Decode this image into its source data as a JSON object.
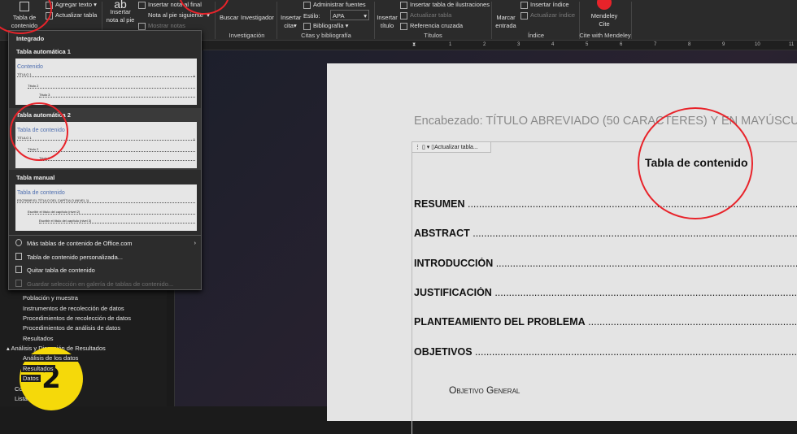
{
  "ribbon": {
    "toc_button": "Tabla de contenido",
    "add_text": "Agregar texto",
    "update_table": "Actualizar tabla",
    "insert_footnote": "Insertar nota al pie",
    "insert_endnote": "Insertar nota al final",
    "next_footnote": "Nota al pie siguiente",
    "show_notes": "Mostrar notas",
    "search": "Buscar",
    "researcher": "Investigador",
    "group_research": "Investigación",
    "insert_citation": "Insertar cita",
    "manage_sources": "Administrar fuentes",
    "style_label": "Estilo:",
    "style_value": "APA",
    "bibliography": "Bibliografía",
    "group_citations": "Citas y bibliografía",
    "insert_caption": "Insertar título",
    "insert_table_figures": "Insertar tabla de ilustraciones",
    "update_table_captions": "Actualizar tabla",
    "cross_reference": "Referencia cruzada",
    "group_captions": "Títulos",
    "mark_entry": "Marcar entrada",
    "insert_index": "Insertar índice",
    "update_index": "Actualizar índice",
    "group_index": "Índice",
    "mendeley": "Mendeley Cite",
    "group_mendeley": "Cite with Mendeley"
  },
  "ruler": [
    "1",
    "2",
    "3",
    "4",
    "5",
    "6",
    "7",
    "8",
    "9",
    "10",
    "11"
  ],
  "menu": {
    "section": "Integrado",
    "auto1": {
      "label": "Tabla automática 1",
      "title": "Contenido",
      "lines": [
        "TÍTULO 1",
        "Título 2",
        "Título 3"
      ],
      "page": "1"
    },
    "auto2": {
      "label": "Tabla automática 2",
      "title": "Tabla de contenido",
      "lines": [
        "TÍTULO 1",
        "Título 2",
        "Título 3"
      ],
      "page": "1"
    },
    "manual": {
      "label": "Tabla manual",
      "title": "Tabla de contenido",
      "lines": [
        "ESCRIBIR EL TÍTULO DEL CAPÍTULO (NIVEL 1)",
        "Escribir el título del capítulo (nivel 2)",
        "Escribir el título del capítulo (nivel 3)"
      ],
      "pages": [
        "1",
        "2",
        "3"
      ]
    },
    "more": "Más tablas de contenido de Office.com",
    "custom": "Tabla de contenido personalizada...",
    "remove": "Quitar tabla de contenido",
    "save": "Guardar selección en galería de tablas de contenido..."
  },
  "nav": {
    "items": [
      "Población y muestra",
      "Instrumentos de recolección de datos",
      "Procedimientos de recolección de datos",
      "Procedimientos de análisis de datos",
      "Resultados",
      "Análisis y Discusión de Resultados",
      "Análisis de los datos",
      "Resultados",
      "Datos",
      "Conclusiones",
      "Lista"
    ]
  },
  "badge": "2",
  "doc": {
    "header": "Encabezado: TÍTULO ABREVIADO (50 CARACTERES) Y EN MAYÚSCULA",
    "toc_control_update": "Actualizar tabla...",
    "toc_title": "Tabla de contenido",
    "entries": [
      "RESUMEN",
      "ABSTRACT",
      "INTRODUCCIÓN",
      "JUSTIFICACIÓN",
      "PLANTEAMIENTO DEL PROBLEMA",
      "OBJETIVOS"
    ],
    "sub_entry": "Objetivo General"
  },
  "colors": {
    "annotation": "#e8232a",
    "badge": "#f5d90a",
    "mendeley": "#e8232a"
  }
}
